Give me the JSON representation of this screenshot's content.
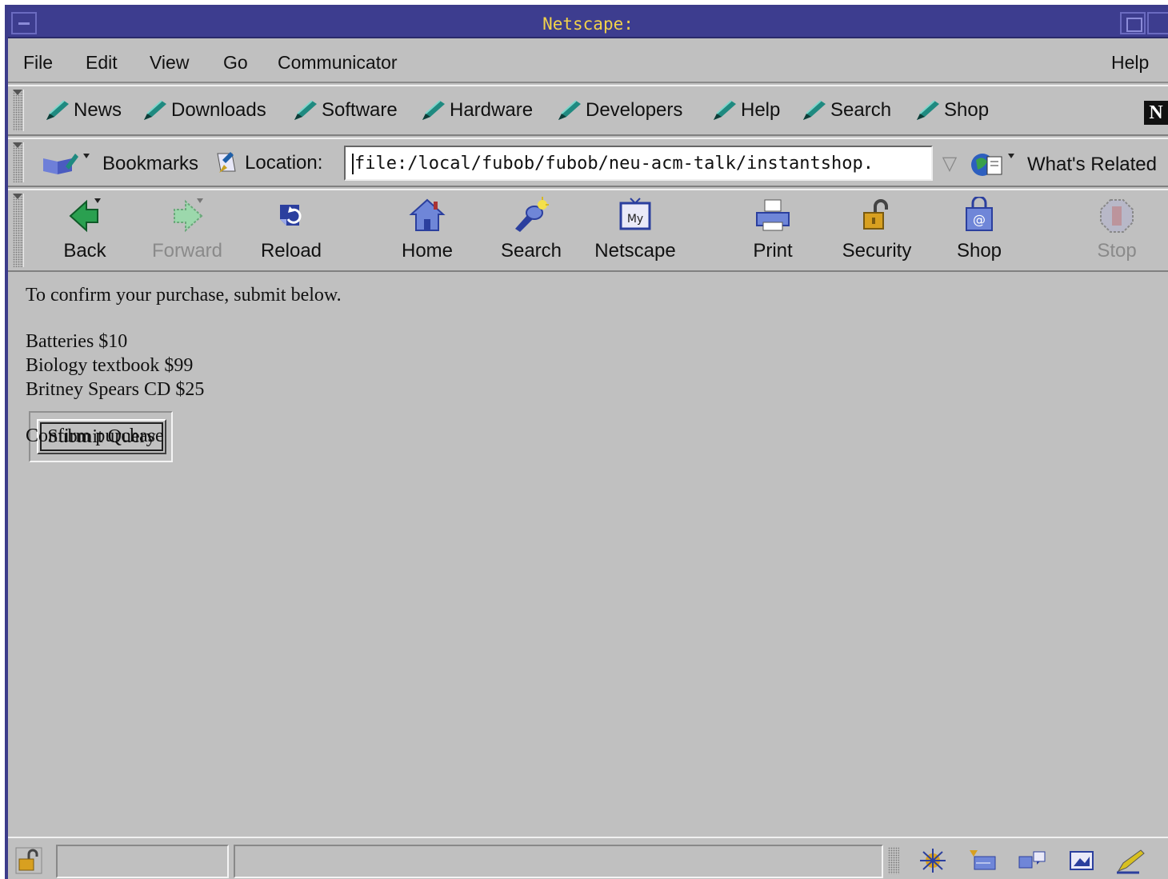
{
  "window": {
    "title": "Netscape:"
  },
  "menubar": {
    "items": [
      "File",
      "Edit",
      "View",
      "Go",
      "Communicator"
    ],
    "help": "Help"
  },
  "personal_toolbar": {
    "items": [
      "News",
      "Downloads",
      "Software",
      "Hardware",
      "Developers",
      "Help",
      "Search",
      "Shop"
    ],
    "logo": "N"
  },
  "location_bar": {
    "bookmarks_label": "Bookmarks",
    "location_label": "Location:",
    "url": "file:/local/fubob/fubob/neu-acm-talk/instantshop.",
    "whats_related": "What's Related"
  },
  "navigation_toolbar": {
    "buttons": [
      {
        "label": "Back",
        "icon": "back-arrow-icon",
        "enabled": true
      },
      {
        "label": "Forward",
        "icon": "forward-arrow-icon",
        "enabled": false
      },
      {
        "label": "Reload",
        "icon": "reload-icon",
        "enabled": true
      },
      {
        "label": "Home",
        "icon": "home-icon",
        "enabled": true
      },
      {
        "label": "Search",
        "icon": "search-icon",
        "enabled": true
      },
      {
        "label": "Netscape",
        "icon": "my-netscape-icon",
        "enabled": true
      },
      {
        "label": "Print",
        "icon": "print-icon",
        "enabled": true
      },
      {
        "label": "Security",
        "icon": "security-lock-icon",
        "enabled": true
      },
      {
        "label": "Shop",
        "icon": "shop-bag-icon",
        "enabled": true
      },
      {
        "label": "Stop",
        "icon": "stop-icon",
        "enabled": false
      }
    ]
  },
  "page": {
    "intro": "To confirm your purchase, submit below.",
    "items": [
      "Batteries $10",
      "Biology textbook $99",
      "Britney Spears CD $25"
    ],
    "submit_label": "Submit Query",
    "confirm_label": "Confirm purchase"
  },
  "colors": {
    "titlebar": "#3d3d8f",
    "title_text": "#f2d24a",
    "chrome": "#c0c0c0",
    "pen_teal": "#1f8a80"
  }
}
